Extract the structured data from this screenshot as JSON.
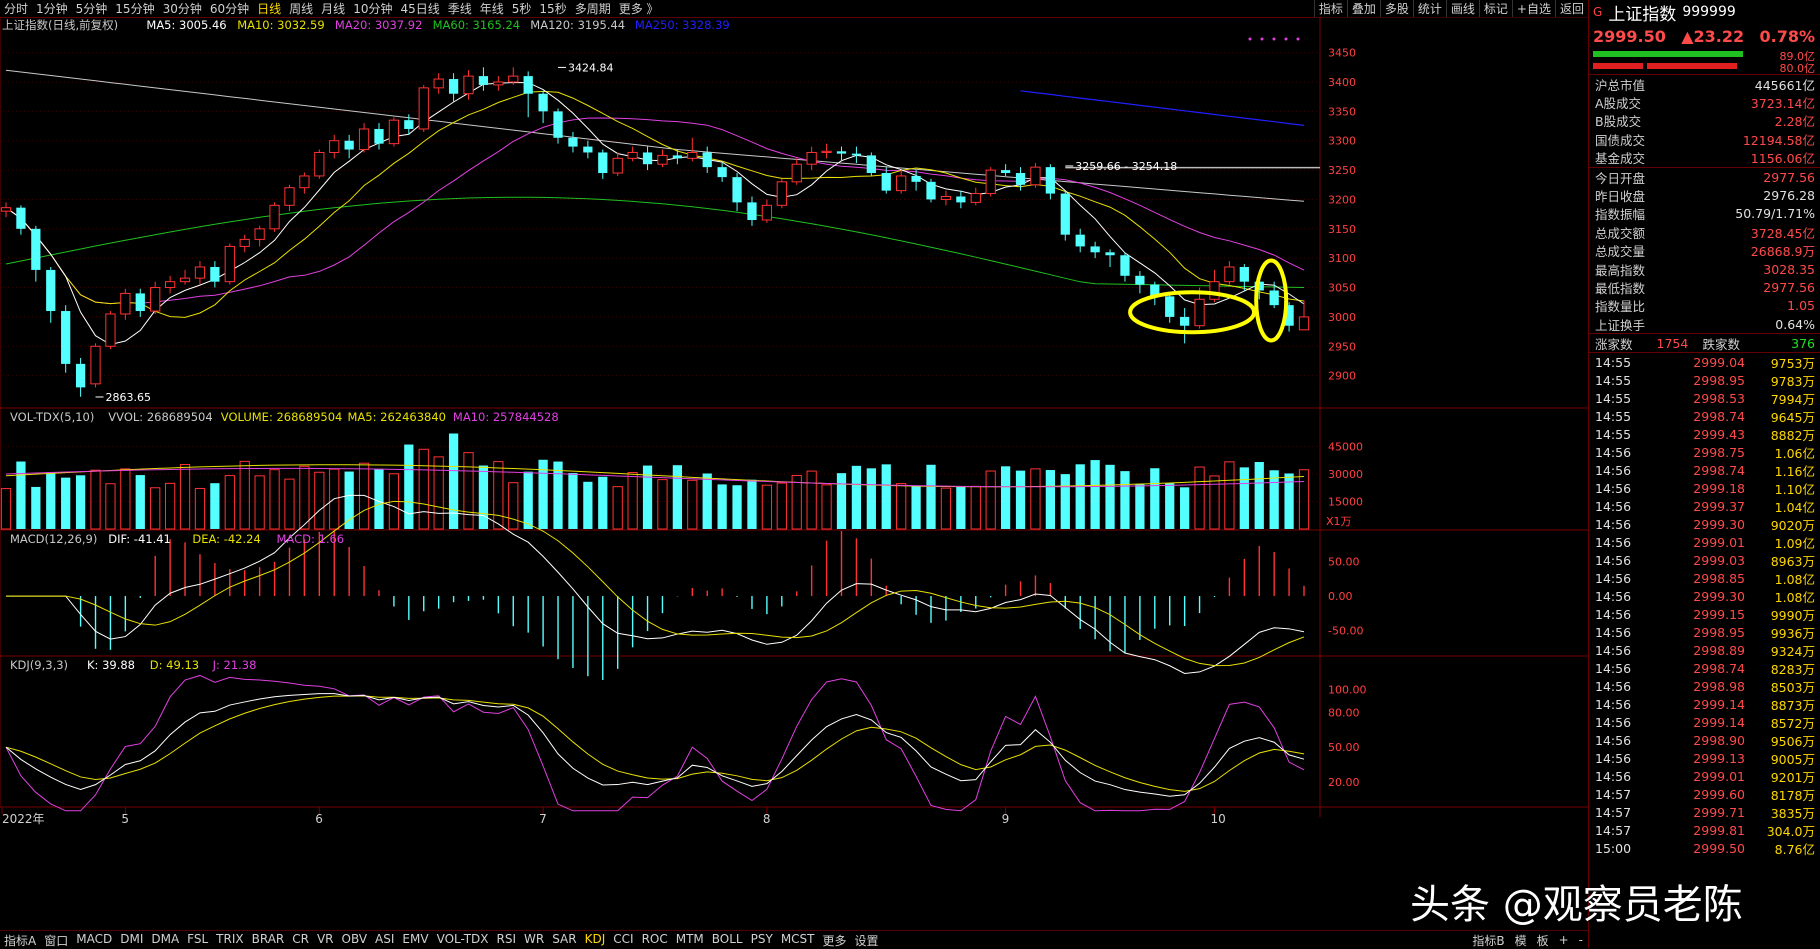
{
  "top_tabs": [
    "分时",
    "1分钟",
    "5分钟",
    "15分钟",
    "30分钟",
    "60分钟",
    "日线",
    "周线",
    "月线",
    "10分钟",
    "45日线",
    "季线",
    "年线",
    "5秒",
    "15秒",
    "多周期",
    "更多 》"
  ],
  "top_tabs_active": 6,
  "top_tools": [
    "指标",
    "叠加",
    "多股",
    "统计",
    "画线",
    "标记",
    "+自选",
    "返回"
  ],
  "main_legend": {
    "name": "上证指数(日线,前复权)",
    "ma": [
      {
        "label": "MA5: 3005.46",
        "color": "#ffffff"
      },
      {
        "label": "MA10: 3032.59",
        "color": "#e8e000"
      },
      {
        "label": "MA20: 3037.92",
        "color": "#e040e0"
      },
      {
        "label": "MA60: 3165.24",
        "color": "#20c020"
      },
      {
        "label": "MA120: 3195.44",
        "color": "#c8c8c8"
      },
      {
        "label": "MA250: 3328.39",
        "color": "#2020ff"
      }
    ]
  },
  "vol_legend": [
    {
      "label": "VOL-TDX(5,10)",
      "color": "#c8c8c8"
    },
    {
      "label": "VVOL: 268689504",
      "color": "#c8c8c8"
    },
    {
      "label": "VOLUME: 268689504",
      "color": "#e8e000"
    },
    {
      "label": "MA5: 262463840",
      "color": "#e8e000"
    },
    {
      "label": "MA10: 257844528",
      "color": "#e040e0"
    }
  ],
  "macd_legend": [
    {
      "label": "MACD(12,26,9)",
      "color": "#c8c8c8"
    },
    {
      "label": "DIF: -41.41",
      "color": "#ffffff"
    },
    {
      "label": "DEA: -42.24",
      "color": "#e8e000"
    },
    {
      "label": "MACD: 1.66",
      "color": "#e040e0"
    }
  ],
  "kdj_legend": [
    {
      "label": "KDJ(9,3,3)",
      "color": "#c8c8c8"
    },
    {
      "label": "K: 39.88",
      "color": "#ffffff"
    },
    {
      "label": "D: 49.13",
      "color": "#e8e000"
    },
    {
      "label": "J: 21.38",
      "color": "#e040e0"
    }
  ],
  "chart_data": {
    "type": "candlestick",
    "title": "上证指数(日线,前复权)",
    "price_axis": {
      "ticks": [
        3450,
        3400,
        3350,
        3300,
        3250,
        3200,
        3150,
        3100,
        3050,
        3000,
        2950,
        2900
      ],
      "ylim": [
        2850,
        3480
      ]
    },
    "vol_axis": {
      "ticks": [
        45000,
        30000,
        15000
      ],
      "unit": "X1万",
      "ylim": [
        0,
        55000
      ]
    },
    "macd_axis": {
      "ticks": [
        "50.00",
        "0.00",
        "-50.00"
      ],
      "ylim": [
        -80,
        70
      ]
    },
    "kdj_axis": {
      "ticks": [
        "100.00",
        "80.00",
        "50.00",
        "20.00"
      ],
      "ylim": [
        0,
        115
      ]
    },
    "annotations": [
      {
        "text": "3424.84",
        "x_index": 37,
        "price": 3424.84
      },
      {
        "text": "2863.65",
        "x_index": 6,
        "price": 2863.65
      },
      {
        "text": "3259.66 - 3254.18",
        "x_index": 71,
        "price": 3257
      }
    ],
    "reference_line": 3254.18,
    "x_labels": [
      {
        "text": "2022年",
        "index": 0
      },
      {
        "text": "5",
        "index": 8
      },
      {
        "text": "6",
        "index": 21
      },
      {
        "text": "7",
        "index": 36
      },
      {
        "text": "8",
        "index": 51
      },
      {
        "text": "9",
        "index": 67
      },
      {
        "text": "10",
        "index": 81
      }
    ],
    "candles": [
      [
        3180,
        3186,
        3195,
        3170
      ],
      [
        3186,
        3150,
        3190,
        3140
      ],
      [
        3150,
        3080,
        3155,
        3060
      ],
      [
        3080,
        3010,
        3085,
        2990
      ],
      [
        3010,
        2920,
        3020,
        2905
      ],
      [
        2920,
        2880,
        2930,
        2864
      ],
      [
        2886,
        2950,
        2955,
        2880
      ],
      [
        2950,
        3005,
        3010,
        2945
      ],
      [
        3005,
        3040,
        3048,
        2995
      ],
      [
        3040,
        3010,
        3048,
        3000
      ],
      [
        3010,
        3050,
        3060,
        3005
      ],
      [
        3050,
        3060,
        3070,
        3040
      ],
      [
        3060,
        3066,
        3080,
        3055
      ],
      [
        3066,
        3085,
        3095,
        3055
      ],
      [
        3085,
        3060,
        3095,
        3050
      ],
      [
        3060,
        3120,
        3125,
        3055
      ],
      [
        3120,
        3132,
        3140,
        3110
      ],
      [
        3132,
        3150,
        3155,
        3120
      ],
      [
        3150,
        3190,
        3195,
        3145
      ],
      [
        3190,
        3220,
        3225,
        3180
      ],
      [
        3220,
        3240,
        3246,
        3210
      ],
      [
        3240,
        3280,
        3285,
        3235
      ],
      [
        3280,
        3300,
        3310,
        3270
      ],
      [
        3300,
        3285,
        3310,
        3270
      ],
      [
        3285,
        3320,
        3330,
        3280
      ],
      [
        3320,
        3295,
        3330,
        3285
      ],
      [
        3295,
        3335,
        3340,
        3290
      ],
      [
        3335,
        3320,
        3345,
        3310
      ],
      [
        3320,
        3390,
        3395,
        3315
      ],
      [
        3390,
        3405,
        3415,
        3380
      ],
      [
        3405,
        3380,
        3415,
        3365
      ],
      [
        3380,
        3410,
        3420,
        3370
      ],
      [
        3410,
        3395,
        3425,
        3385
      ],
      [
        3395,
        3400,
        3410,
        3385
      ],
      [
        3400,
        3410,
        3425,
        3395
      ],
      [
        3410,
        3380,
        3418,
        3340
      ],
      [
        3380,
        3350,
        3385,
        3330
      ],
      [
        3350,
        3305,
        3355,
        3295
      ],
      [
        3305,
        3290,
        3315,
        3280
      ],
      [
        3290,
        3280,
        3300,
        3270
      ],
      [
        3280,
        3245,
        3285,
        3235
      ],
      [
        3245,
        3270,
        3280,
        3240
      ],
      [
        3270,
        3280,
        3290,
        3265
      ],
      [
        3280,
        3260,
        3290,
        3250
      ],
      [
        3260,
        3275,
        3285,
        3255
      ],
      [
        3275,
        3270,
        3285,
        3260
      ],
      [
        3270,
        3280,
        3305,
        3265
      ],
      [
        3280,
        3255,
        3290,
        3245
      ],
      [
        3255,
        3238,
        3262,
        3230
      ],
      [
        3238,
        3195,
        3245,
        3180
      ],
      [
        3195,
        3165,
        3205,
        3155
      ],
      [
        3165,
        3190,
        3200,
        3160
      ],
      [
        3190,
        3230,
        3235,
        3185
      ],
      [
        3230,
        3260,
        3270,
        3225
      ],
      [
        3260,
        3280,
        3290,
        3250
      ],
      [
        3280,
        3282,
        3295,
        3270
      ],
      [
        3282,
        3278,
        3290,
        3265
      ],
      [
        3278,
        3275,
        3290,
        3262
      ],
      [
        3275,
        3245,
        3280,
        3240
      ],
      [
        3245,
        3215,
        3255,
        3210
      ],
      [
        3215,
        3240,
        3250,
        3210
      ],
      [
        3240,
        3230,
        3250,
        3215
      ],
      [
        3230,
        3200,
        3235,
        3195
      ],
      [
        3200,
        3205,
        3215,
        3190
      ],
      [
        3205,
        3195,
        3215,
        3185
      ],
      [
        3195,
        3210,
        3220,
        3190
      ],
      [
        3210,
        3250,
        3255,
        3205
      ],
      [
        3250,
        3245,
        3260,
        3240
      ],
      [
        3245,
        3225,
        3255,
        3215
      ],
      [
        3225,
        3255,
        3262,
        3220
      ],
      [
        3255,
        3210,
        3260,
        3200
      ],
      [
        3210,
        3140,
        3215,
        3130
      ],
      [
        3140,
        3120,
        3150,
        3110
      ],
      [
        3120,
        3110,
        3128,
        3100
      ],
      [
        3110,
        3105,
        3115,
        3085
      ],
      [
        3105,
        3070,
        3110,
        3060
      ],
      [
        3070,
        3055,
        3078,
        3040
      ],
      [
        3055,
        3035,
        3060,
        3020
      ],
      [
        3035,
        3000,
        3040,
        2990
      ],
      [
        3000,
        2985,
        3015,
        2955
      ],
      [
        2985,
        3030,
        3050,
        2980
      ],
      [
        3030,
        3060,
        3080,
        3025
      ],
      [
        3060,
        3085,
        3095,
        3055
      ],
      [
        3085,
        3060,
        3090,
        3045
      ],
      [
        3060,
        3045,
        3070,
        3030
      ],
      [
        3045,
        3020,
        3060,
        3015
      ],
      [
        3020,
        2985,
        3025,
        2975
      ],
      [
        2978,
        3000,
        3028,
        2977
      ]
    ],
    "series": [
      {
        "name": "MA5",
        "color": "#ffffff"
      },
      {
        "name": "MA10",
        "color": "#e8e000"
      },
      {
        "name": "MA20",
        "color": "#e040e0"
      },
      {
        "name": "MA60",
        "color": "#20c020"
      },
      {
        "name": "MA120",
        "color": "#c8c8c8"
      },
      {
        "name": "MA250",
        "color": "#2020ff"
      }
    ]
  },
  "side": {
    "g_label": "G",
    "name": "上证指数",
    "code": "999999",
    "price": "2999.50",
    "change": "▲23.22",
    "pct": "0.78%",
    "bar1_val": "89.0亿",
    "bar2_val": "80.0亿",
    "rows": [
      {
        "k": "沪总市值",
        "v": "445661亿",
        "c": "w"
      },
      {
        "k": "A股成交",
        "v": "3723.14亿",
        "c": "r"
      },
      {
        "k": "B股成交",
        "v": "2.28亿",
        "c": "r"
      },
      {
        "k": "国债成交",
        "v": "12194.58亿",
        "c": "r"
      },
      {
        "k": "基金成交",
        "v": "1156.06亿",
        "c": "r"
      }
    ],
    "rows2": [
      {
        "k": "今日开盘",
        "v": "2977.56",
        "c": "r"
      },
      {
        "k": "昨日收盘",
        "v": "2976.28",
        "c": "w"
      },
      {
        "k": "指数振幅",
        "v": "50.79/1.71%",
        "c": "w"
      },
      {
        "k": "总成交额",
        "v": "3728.45亿",
        "c": "r"
      },
      {
        "k": "总成交量",
        "v": "26868.9万",
        "c": "r"
      },
      {
        "k": "最高指数",
        "v": "3028.35",
        "c": "r"
      },
      {
        "k": "最低指数",
        "v": "2977.56",
        "c": "r"
      },
      {
        "k": "指数量比",
        "v": "1.05",
        "c": "r"
      },
      {
        "k": "上证换手",
        "v": "0.64%",
        "c": "w"
      }
    ],
    "up_label": "涨家数",
    "up_count": "1754",
    "down_label": "跌家数",
    "down_count": "376",
    "ticks": [
      [
        "14:55",
        "2999.04",
        "9753万"
      ],
      [
        "14:55",
        "2998.95",
        "9783万"
      ],
      [
        "14:55",
        "2998.53",
        "7994万"
      ],
      [
        "14:55",
        "2998.74",
        "9645万"
      ],
      [
        "14:55",
        "2999.43",
        "8882万"
      ],
      [
        "14:56",
        "2998.75",
        "1.06亿"
      ],
      [
        "14:56",
        "2998.74",
        "1.16亿"
      ],
      [
        "14:56",
        "2999.18",
        "1.10亿"
      ],
      [
        "14:56",
        "2999.37",
        "1.04亿"
      ],
      [
        "14:56",
        "2999.30",
        "9020万"
      ],
      [
        "14:56",
        "2999.01",
        "1.09亿"
      ],
      [
        "14:56",
        "2999.03",
        "8963万"
      ],
      [
        "14:56",
        "2998.85",
        "1.08亿"
      ],
      [
        "14:56",
        "2999.30",
        "1.08亿"
      ],
      [
        "14:56",
        "2999.15",
        "9990万"
      ],
      [
        "14:56",
        "2998.95",
        "9936万"
      ],
      [
        "14:56",
        "2998.89",
        "9324万"
      ],
      [
        "14:56",
        "2998.74",
        "8283万"
      ],
      [
        "14:56",
        "2998.98",
        "8503万"
      ],
      [
        "14:56",
        "2999.14",
        "8873万"
      ],
      [
        "14:56",
        "2999.14",
        "8572万"
      ],
      [
        "14:56",
        "2998.90",
        "9506万"
      ],
      [
        "14:56",
        "2999.13",
        "9005万"
      ],
      [
        "14:56",
        "2999.01",
        "9201万"
      ],
      [
        "14:57",
        "2999.60",
        "8178万"
      ],
      [
        "14:57",
        "2999.71",
        "3835万"
      ],
      [
        "14:57",
        "2999.81",
        "304.0万"
      ]
    ],
    "last_tick": [
      "15:00",
      "2999.50",
      "8.76亿"
    ]
  },
  "bottom_tabs": [
    "指标A",
    "窗口",
    "MACD",
    "DMI",
    "DMA",
    "FSL",
    "TRIX",
    "BRAR",
    "CR",
    "VR",
    "OBV",
    "ASI",
    "EMV",
    "VOL-TDX",
    "RSI",
    "WR",
    "SAR",
    "KDJ",
    "CCI",
    "ROC",
    "MTM",
    "BOLL",
    "PSY",
    "MCST",
    "更多",
    "设置"
  ],
  "bottom_tabs_active": 17,
  "bottom_right": [
    "指标B",
    "模",
    "板",
    "+",
    "-"
  ],
  "watermark": "头条 @观察员老陈",
  "colors": {
    "up": "#ff3232",
    "down": "#54ffff",
    "bg": "#000000",
    "grid": "#7a0000",
    "highlight": "#ffff00"
  }
}
